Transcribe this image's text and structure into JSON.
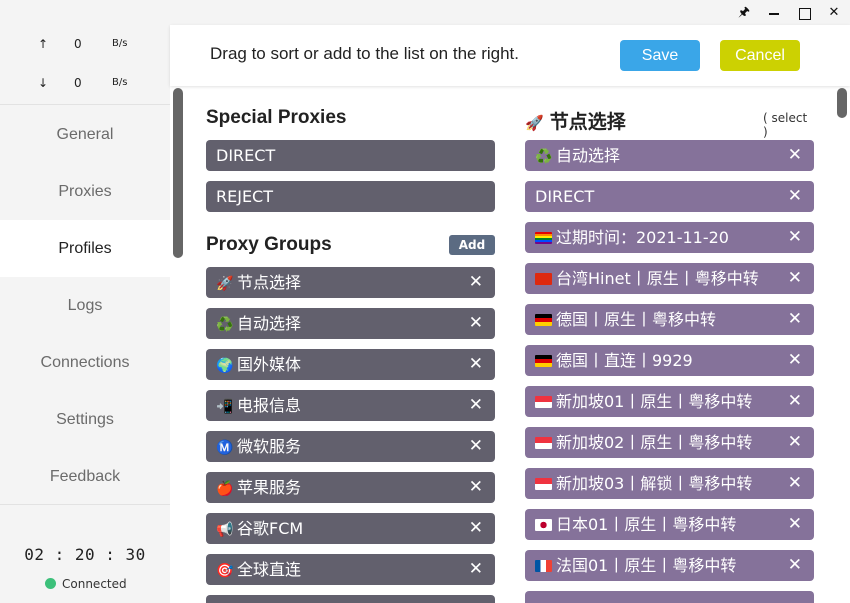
{
  "window_controls": {
    "pin": "🖈",
    "close": "✕"
  },
  "sidebar": {
    "traffic": {
      "up": {
        "arrow": "↑",
        "value": "0",
        "unit": "B/s"
      },
      "down": {
        "arrow": "↓",
        "value": "0",
        "unit": "B/s"
      }
    },
    "items": [
      {
        "label": "General"
      },
      {
        "label": "Proxies"
      },
      {
        "label": "Profiles"
      },
      {
        "label": "Logs"
      },
      {
        "label": "Connections"
      },
      {
        "label": "Settings"
      },
      {
        "label": "Feedback"
      }
    ],
    "active": "Profiles",
    "clock": "02 : 20 : 30",
    "status": "Connected",
    "status_color": "#3cc07a"
  },
  "header": {
    "message": "Drag to sort or add to the list on the right.",
    "save_label": "Save",
    "cancel_label": "Cancel",
    "save_color": "#3aa6e8",
    "cancel_color": "#ccd102"
  },
  "left": {
    "special_title": "Special Proxies",
    "special": [
      {
        "label": "DIRECT"
      },
      {
        "label": "REJECT"
      }
    ],
    "groups_title": "Proxy Groups",
    "add_label": "Add",
    "groups": [
      {
        "icon": "🚀",
        "label": "节点选择"
      },
      {
        "icon": "♻️",
        "label": "自动选择"
      },
      {
        "icon": "🌍",
        "label": "国外媒体"
      },
      {
        "icon": "📲",
        "label": "电报信息"
      },
      {
        "icon": "Ⓜ️",
        "label": "微软服务"
      },
      {
        "icon": "🍎",
        "label": "苹果服务"
      },
      {
        "icon": "📢",
        "label": "谷歌FCM"
      },
      {
        "icon": "🎯",
        "label": "全球直连"
      }
    ]
  },
  "right": {
    "title_icon": "🚀",
    "title": "节点选择",
    "type_label": "( select )",
    "items": [
      {
        "icon": "♻️",
        "label": "自动选择"
      },
      {
        "icon": "",
        "label": "DIRECT"
      },
      {
        "flag": "rainbow",
        "label": "过期时间：2021-11-20"
      },
      {
        "flag": "cn",
        "label": "台湾Hinet丨原生丨粤移中转"
      },
      {
        "flag": "de",
        "label": "德国丨原生丨粤移中转"
      },
      {
        "flag": "de",
        "label": "德国丨直连丨9929"
      },
      {
        "flag": "sg",
        "label": "新加坡01丨原生丨粤移中转"
      },
      {
        "flag": "sg",
        "label": "新加坡02丨原生丨粤移中转"
      },
      {
        "flag": "sg",
        "label": "新加坡03丨解锁丨粤移中转"
      },
      {
        "flag": "jp",
        "label": "日本01丨原生丨粤移中转"
      },
      {
        "flag": "fr",
        "label": "法国01丨原生丨粤移中转"
      }
    ]
  },
  "remove_glyph": "✕"
}
